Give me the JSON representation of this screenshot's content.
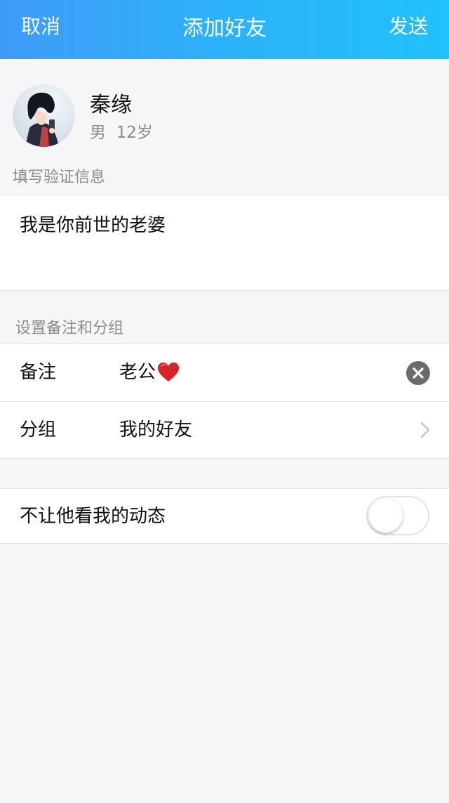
{
  "nav": {
    "cancel_label": "取消",
    "title": "添加好友",
    "send_label": "发送"
  },
  "profile": {
    "avatar_icon": "profile-avatar",
    "name": "秦缘",
    "gender": "男",
    "age": "12岁"
  },
  "verification": {
    "section_label": "填写验证信息",
    "message": "我是你前世的老婆"
  },
  "settings": {
    "section_label": "设置备注和分组",
    "remark": {
      "label": "备注",
      "value": "老公",
      "emoji_icon": "heart-icon",
      "clear_icon": "clear-icon"
    },
    "group": {
      "label": "分组",
      "value": "我的好友",
      "arrow_icon": "chevron-right-icon"
    }
  },
  "privacy": {
    "hide_moments_label": "不让他看我的动态",
    "hide_moments_enabled": false
  },
  "colors": {
    "nav_gradient_start": "#3f9bf8",
    "nav_gradient_end": "#20c1fc",
    "background": "#f6f6f9",
    "clear_icon": "#6b6b6b",
    "heart": "#d8232a"
  }
}
